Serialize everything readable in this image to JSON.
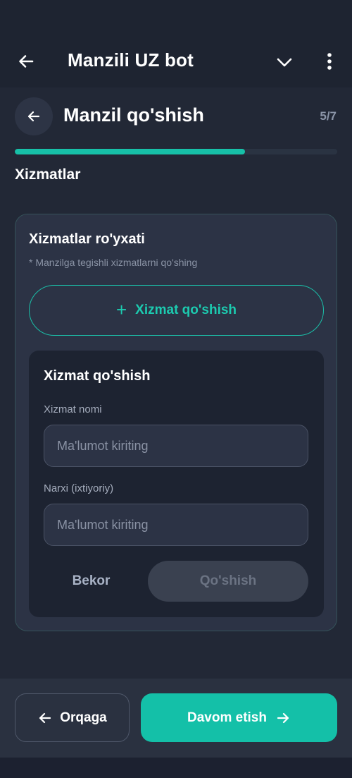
{
  "app_bar": {
    "title": "Manzili UZ bot",
    "back_icon": "arrow-left-icon",
    "dropdown_icon": "chevron-down-icon",
    "menu_icon": "more-vertical-icon"
  },
  "header": {
    "title": "Manzil qo'shish",
    "step": "5/7"
  },
  "progress": {
    "fraction": 0.714,
    "fill_color": "#17c0a8",
    "track_color": "#2a3342"
  },
  "section": {
    "title": "Xizmatlar"
  },
  "services_card": {
    "title": "Xizmatlar ro'yxati",
    "hint": "* Manzilga tegishli xizmatlarni qo'shing",
    "add_button": "Xizmat qo'shish",
    "add_icon": "plus-icon"
  },
  "form": {
    "title": "Xizmat qo'shish",
    "name_label": "Xizmat nomi",
    "name_placeholder": "Ma'lumot kiriting",
    "price_label": "Narxi (ixtiyoriy)",
    "price_placeholder": "Ma'lumot kiriting",
    "cancel_label": "Bekor",
    "submit_label": "Qo'shish"
  },
  "footer": {
    "back_label": "Orqaga",
    "next_label": "Davom etish"
  },
  "colors": {
    "accent": "#14c0a8",
    "background": "#222836",
    "card": "#2c3345"
  }
}
